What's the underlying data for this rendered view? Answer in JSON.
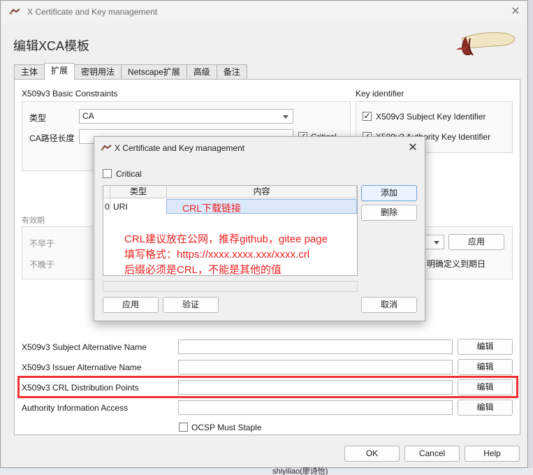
{
  "window": {
    "title": "X Certificate and Key management",
    "heading": "编辑XCA模板"
  },
  "tabs": [
    "主体",
    "扩展",
    "密钥用法",
    "Netscape扩展",
    "高级",
    "备注"
  ],
  "basic_constraints": {
    "title": "X509v3 Basic Constraints",
    "type_label": "类型",
    "type_value": "CA",
    "pathlen_label": "CA路径长度",
    "critical_label": "Critical"
  },
  "key_identifier": {
    "title": "Key identifier",
    "subject_label": "X509v3 Subject Key Identifier",
    "authority_label": "X509v3 Authority Key Identifier"
  },
  "validity": {
    "title": "有效期",
    "not_before": "不早于",
    "not_after": "不晚于",
    "apply": "应用",
    "midnight_fragment": "明确定义到期日"
  },
  "extensions": {
    "san_label": "X509v3 Subject Alternative Name",
    "ian_label": "X509v3 Issuer Alternative Name",
    "crl_label": "X509v3 CRL Distribution Points",
    "aia_label": "Authority Information Access",
    "edit": "编辑",
    "ocsp_label": "OCSP Must Staple"
  },
  "footer": {
    "ok": "OK",
    "cancel": "Cancel",
    "help": "Help"
  },
  "dialog": {
    "title": "X Certificate and Key management",
    "critical": "Critical",
    "col_type": "类型",
    "col_content": "内容",
    "row_index": "0",
    "row_type": "URI",
    "row_content": "CRL下载链接",
    "note1": "CRL建议放在公网，推荐github，gitee page",
    "note2": "填写格式：https://xxxx.xxxx.xxx/xxxx.crl",
    "note3": "后缀必须是CRL，不能是其他的值",
    "add": "添加",
    "delete": "删除",
    "apply": "应用",
    "validate": "验证",
    "cancel": "取消"
  },
  "taskbar": {
    "user": "shiyiliao(廖诗怡)"
  },
  "colors": {
    "annotation_red": "#ee2222",
    "highlight_blue": "#dbe9fb"
  }
}
